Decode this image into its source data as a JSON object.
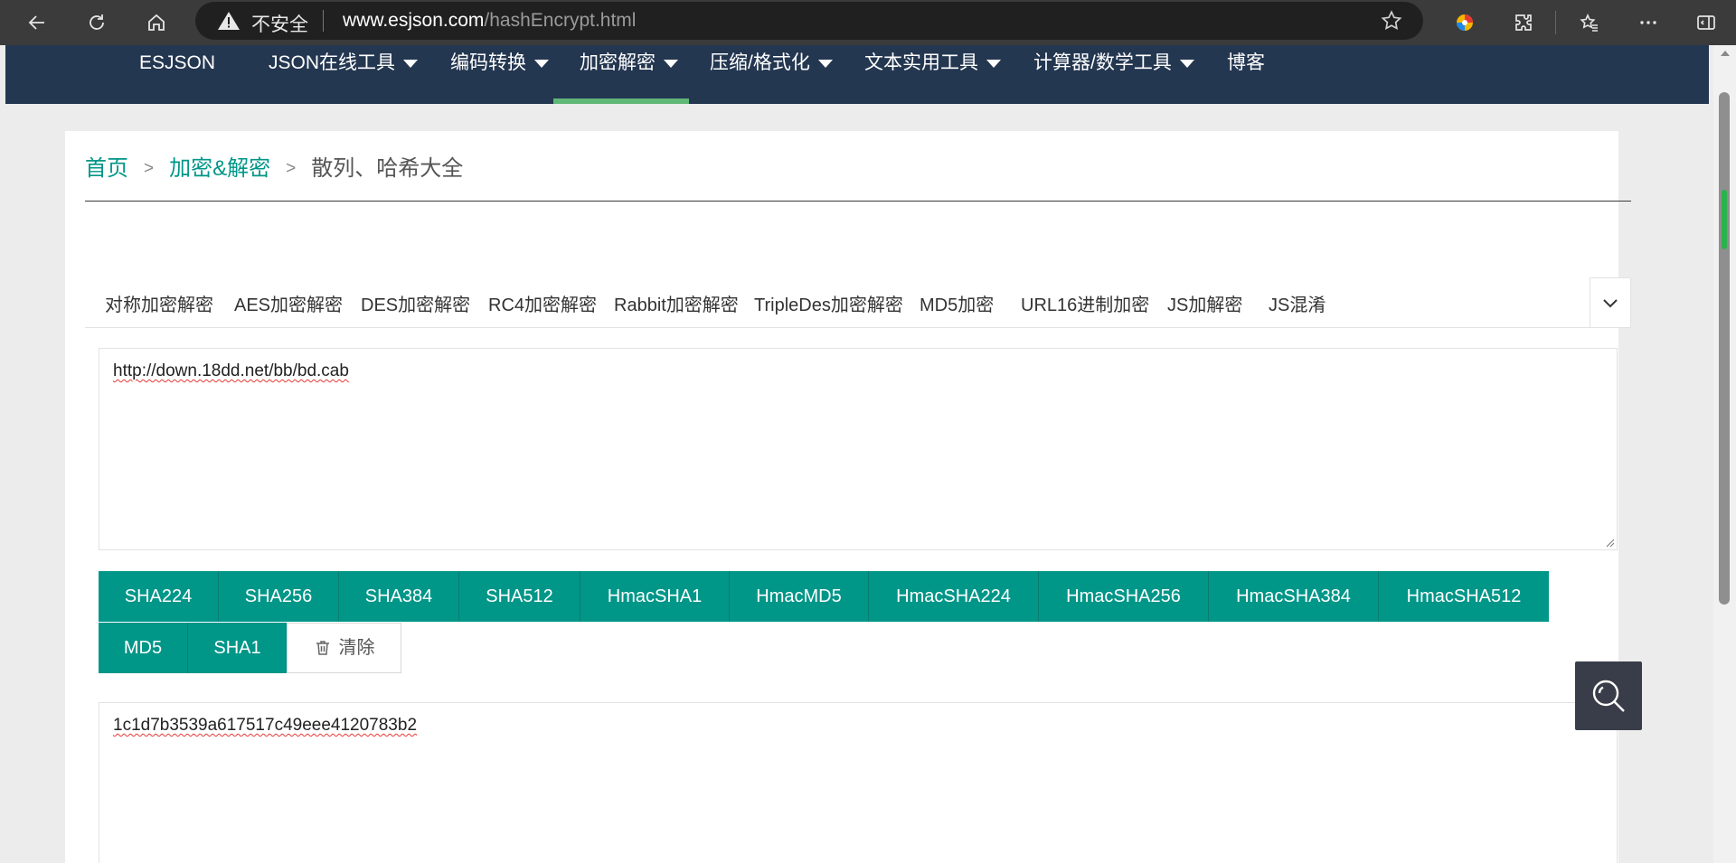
{
  "browser": {
    "insecure_label": "不安全",
    "url_host": "www.esjson.com",
    "url_path": "/hashEncrypt.html"
  },
  "site_nav": {
    "brand": "ESJSON",
    "items": [
      {
        "label": "JSON在线工具",
        "dropdown": true
      },
      {
        "label": "编码转换",
        "dropdown": true
      },
      {
        "label": "加密解密",
        "dropdown": true,
        "active": true
      },
      {
        "label": "压缩/格式化",
        "dropdown": true
      },
      {
        "label": "文本实用工具",
        "dropdown": true
      },
      {
        "label": "计算器/数学工具",
        "dropdown": true
      },
      {
        "label": "博客",
        "dropdown": false
      }
    ],
    "active_color": "#5fb878",
    "bg_color": "#243751"
  },
  "breadcrumb": {
    "home": "首页",
    "category": "加密&解密",
    "current": "散列、哈希大全",
    "separator": ">"
  },
  "tabs": [
    "对称加密解密",
    "AES加密解密",
    "DES加密解密",
    "RC4加密解密",
    "Rabbit加密解密",
    "TripleDes加密解密",
    "MD5加密",
    "URL16进制加密",
    "JS加解密",
    "JS混淆"
  ],
  "input": {
    "value": "http://down.18dd.net/bb/bd.cab"
  },
  "buttons_row1": [
    "SHA224",
    "SHA256",
    "SHA384",
    "SHA512",
    "HmacSHA1",
    "HmacMD5",
    "HmacSHA224",
    "HmacSHA256",
    "HmacSHA384",
    "HmacSHA512"
  ],
  "buttons_row2": [
    "MD5",
    "SHA1"
  ],
  "clear_label": "清除",
  "output": {
    "value": "1c1d7b3539a617517c49eee4120783b2"
  },
  "colors": {
    "accent": "#009688",
    "fab": "#393d49"
  },
  "icons": {
    "back": "back-arrow-icon",
    "refresh": "refresh-icon",
    "home": "home-icon",
    "warning": "warning-icon",
    "star": "star-icon",
    "trash": "trash-icon",
    "search": "search-icon"
  }
}
